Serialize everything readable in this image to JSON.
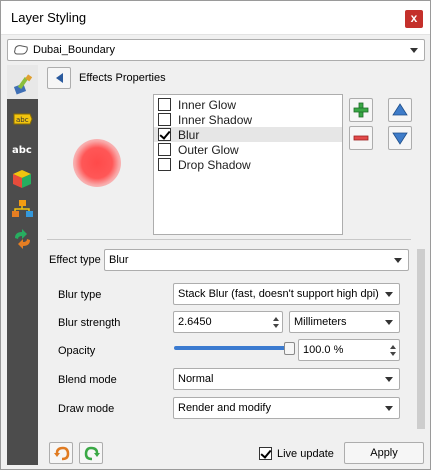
{
  "window": {
    "title": "Layer Styling",
    "close_label": "x"
  },
  "layer": {
    "name": "Dubai_Boundary"
  },
  "panel": {
    "header": "Effects Properties"
  },
  "effects": [
    {
      "label": "Inner Glow",
      "checked": false,
      "selected": false
    },
    {
      "label": "Inner Shadow",
      "checked": false,
      "selected": false
    },
    {
      "label": "Blur",
      "checked": true,
      "selected": true
    },
    {
      "label": "Outer Glow",
      "checked": false,
      "selected": false
    },
    {
      "label": "Drop Shadow",
      "checked": false,
      "selected": false
    }
  ],
  "effect_type": {
    "label": "Effect type",
    "value": "Blur"
  },
  "properties": {
    "blur_type": {
      "label": "Blur type",
      "value": "Stack Blur (fast, doesn't support high dpi)"
    },
    "blur_strength": {
      "label": "Blur strength",
      "value": "2.6450",
      "unit": "Millimeters"
    },
    "opacity": {
      "label": "Opacity",
      "value": "100.0 %",
      "fraction": 1.0
    },
    "blend_mode": {
      "label": "Blend mode",
      "value": "Normal"
    },
    "draw_mode": {
      "label": "Draw mode",
      "value": "Render and modify"
    }
  },
  "bottom": {
    "live_update_label": "Live update",
    "live_update_checked": true,
    "apply_label": "Apply"
  },
  "colors": {
    "accent": "#3b7bd0",
    "preview": "#ff4a4a",
    "close": "#c4302b",
    "sidebar": "#4c4c4c"
  },
  "icons": [
    "paintbrush-icon",
    "label-abc-icon",
    "label-abc-alt-icon",
    "3d-cube-icon",
    "diagram-icon",
    "history-icon",
    "back-arrow-icon",
    "add-effect-icon",
    "remove-effect-icon",
    "move-up-icon",
    "move-down-icon",
    "undo-icon",
    "redo-icon",
    "polygon-layer-icon"
  ]
}
